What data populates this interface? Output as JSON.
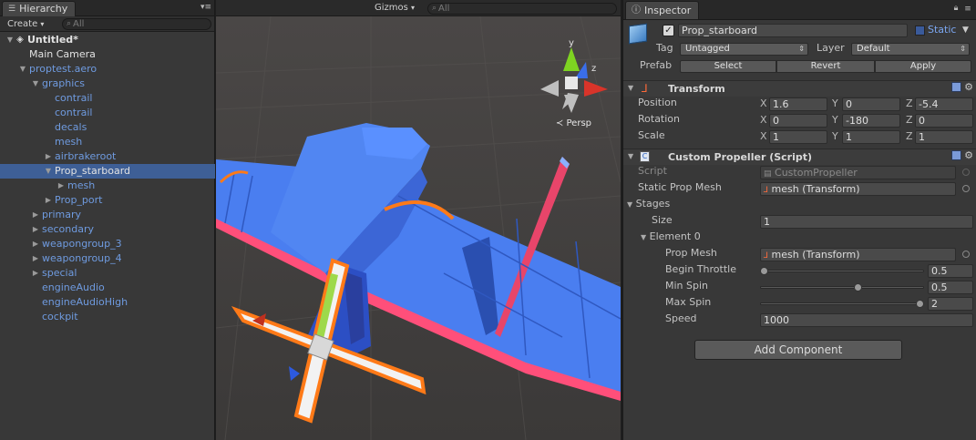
{
  "hierarchy": {
    "tab_title": "Hierarchy",
    "create_label": "Create",
    "search_placeholder": "All",
    "rows": [
      {
        "label": "Untitled*",
        "depth": 0,
        "arrow": "open",
        "style": "scene"
      },
      {
        "label": "Main Camera",
        "depth": 1,
        "arrow": "none",
        "style": "white"
      },
      {
        "label": "proptest.aero",
        "depth": 1,
        "arrow": "open",
        "style": "blue"
      },
      {
        "label": "graphics",
        "depth": 2,
        "arrow": "open",
        "style": "blue"
      },
      {
        "label": "contrail",
        "depth": 3,
        "arrow": "none",
        "style": "blue"
      },
      {
        "label": "contrail",
        "depth": 3,
        "arrow": "none",
        "style": "blue"
      },
      {
        "label": "decals",
        "depth": 3,
        "arrow": "none",
        "style": "blue"
      },
      {
        "label": "mesh",
        "depth": 3,
        "arrow": "none",
        "style": "blue"
      },
      {
        "label": "airbrakeroot",
        "depth": 3,
        "arrow": "closed",
        "style": "blue"
      },
      {
        "label": "Prop_starboard",
        "depth": 3,
        "arrow": "open",
        "style": "selected"
      },
      {
        "label": "mesh",
        "depth": 4,
        "arrow": "closed",
        "style": "blue"
      },
      {
        "label": "Prop_port",
        "depth": 3,
        "arrow": "closed",
        "style": "blue"
      },
      {
        "label": "primary",
        "depth": 2,
        "arrow": "closed",
        "style": "blue"
      },
      {
        "label": "secondary",
        "depth": 2,
        "arrow": "closed",
        "style": "blue"
      },
      {
        "label": "weapongroup_3",
        "depth": 2,
        "arrow": "closed",
        "style": "blue"
      },
      {
        "label": "weapongroup_4",
        "depth": 2,
        "arrow": "closed",
        "style": "blue"
      },
      {
        "label": "special",
        "depth": 2,
        "arrow": "closed",
        "style": "blue"
      },
      {
        "label": "engineAudio",
        "depth": 2,
        "arrow": "none",
        "style": "blue"
      },
      {
        "label": "engineAudioHigh",
        "depth": 2,
        "arrow": "none",
        "style": "blue"
      },
      {
        "label": "cockpit",
        "depth": 2,
        "arrow": "none",
        "style": "blue"
      }
    ]
  },
  "scene": {
    "gizmos_label": "Gizmos",
    "search_placeholder": "All",
    "view_label": "Persp",
    "axis_labels": {
      "y": "y",
      "z": "z"
    }
  },
  "inspector": {
    "tab_title": "Inspector",
    "object_name": "Prop_starboard",
    "static_label": "Static",
    "tag_label": "Tag",
    "tag_value": "Untagged",
    "layer_label": "Layer",
    "layer_value": "Default",
    "prefab_label": "Prefab",
    "prefab_buttons": {
      "select": "Select",
      "revert": "Revert",
      "apply": "Apply"
    },
    "transform": {
      "title": "Transform",
      "position_label": "Position",
      "rotation_label": "Rotation",
      "scale_label": "Scale",
      "position": {
        "x": "1.6",
        "y": "0",
        "z": "-5.4"
      },
      "rotation": {
        "x": "0",
        "y": "-180",
        "z": "0"
      },
      "scale": {
        "x": "1",
        "y": "1",
        "z": "1"
      },
      "axis": {
        "x": "X",
        "y": "Y",
        "z": "Z"
      }
    },
    "propeller": {
      "title": "Custom Propeller (Script)",
      "script_label": "Script",
      "script_value": "CustomPropeller",
      "static_mesh_label": "Static Prop Mesh",
      "static_mesh_value": "mesh (Transform)",
      "stages_label": "Stages",
      "size_label": "Size",
      "size_value": "1",
      "element_label": "Element 0",
      "prop_mesh_label": "Prop Mesh",
      "prop_mesh_value": "mesh (Transform)",
      "begin_throttle_label": "Begin Throttle",
      "begin_throttle_value": "0.5",
      "min_spin_label": "Min Spin",
      "min_spin_value": "0.5",
      "max_spin_label": "Max Spin",
      "max_spin_value": "2",
      "speed_label": "Speed",
      "speed_value": "1000",
      "sliders": {
        "begin_throttle": 0.0,
        "min_spin": 0.6,
        "max_spin": 1.0
      }
    },
    "add_component_label": "Add Component"
  },
  "colors": {
    "selection": "#3e5f96",
    "prefab_blue": "#6f9be0",
    "plane_blue": "#4a7ef0",
    "plane_pink": "#ff4f7a",
    "gizmo_orange": "#ff7a18"
  }
}
